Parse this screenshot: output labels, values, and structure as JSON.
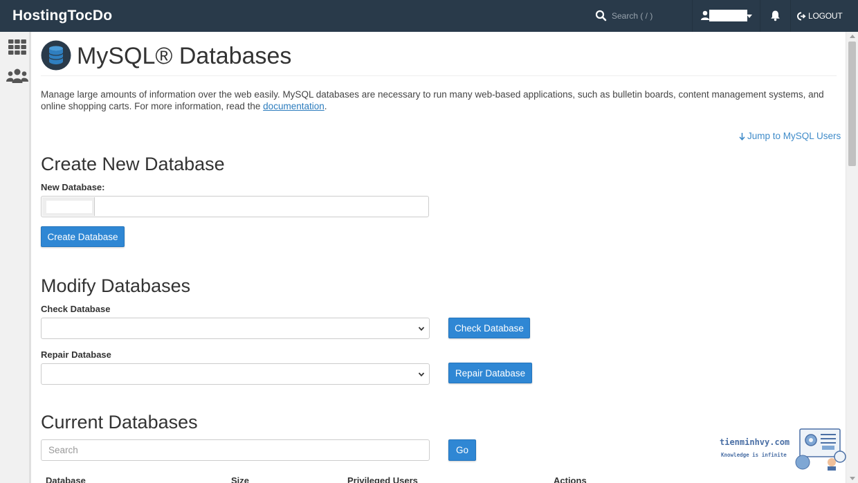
{
  "header": {
    "brand": "HostingTocDo",
    "search_placeholder": "Search ( / )",
    "logout_label": "LOGOUT"
  },
  "page": {
    "title": "MySQL® Databases",
    "description_text": "Manage large amounts of information over the web easily. MySQL databases are necessary to run many web-based applications, such as bulletin boards, content management systems, and online shopping carts. For more information, read the ",
    "description_link": "documentation",
    "description_end": ".",
    "jump_link": "Jump to MySQL Users"
  },
  "create": {
    "heading": "Create New Database",
    "label": "New Database:",
    "button": "Create Database"
  },
  "modify": {
    "heading": "Modify Databases",
    "check_label": "Check Database",
    "check_button": "Check Database",
    "repair_label": "Repair Database",
    "repair_button": "Repair Database"
  },
  "current": {
    "heading": "Current Databases",
    "search_placeholder": "Search",
    "go_button": "Go",
    "columns": [
      "Database",
      "Size",
      "Privileged Users",
      "Actions"
    ]
  },
  "watermark": {
    "site": "tienminhvy.com",
    "tagline": "Knowledge is infinite"
  },
  "colors": {
    "topbar": "#293a4a",
    "button": "#2f87d4",
    "link": "#2a7bbd"
  }
}
